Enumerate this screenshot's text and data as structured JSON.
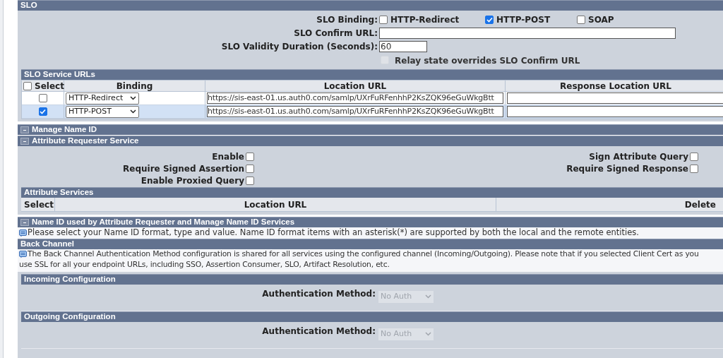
{
  "slo": {
    "title": "SLO",
    "binding_label": "SLO Binding:",
    "bindings": [
      {
        "label": "HTTP-Redirect",
        "checked": false
      },
      {
        "label": "HTTP-POST",
        "checked": true
      },
      {
        "label": "SOAP",
        "checked": false
      }
    ],
    "confirm_url_label": "SLO Confirm URL:",
    "validity_label": "SLO Validity Duration (Seconds):",
    "validity_value": "60",
    "relay": {
      "label": "Relay state overrides SLO Confirm URL",
      "checked": false,
      "disabled": true
    },
    "service_urls": {
      "title": "SLO Service URLs",
      "select_all": {
        "label": "Select",
        "checked": false
      },
      "columns": [
        "Binding",
        "Location URL",
        "Response Location URL"
      ],
      "rows": [
        {
          "selected": false,
          "binding": "HTTP-Redirect",
          "location": "https://sis-east-01.us.auth0.com/samlp/UXrFuRFenhhP2KsZQK96eGuWkgBtt"
        },
        {
          "selected": true,
          "binding": "HTTP-POST",
          "location": "https://sis-east-01.us.auth0.com/samlp/UXrFuRFenhhP2KsZQK96eGuWkgBtt"
        }
      ]
    }
  },
  "manage_name_id": {
    "title": "Manage Name ID"
  },
  "attribute_requester": {
    "title": "Attribute Requester Service",
    "left_options": [
      {
        "label": "Enable",
        "checked": false
      },
      {
        "label": "Require Signed Assertion",
        "checked": false
      },
      {
        "label": "Enable Proxied Query",
        "checked": false
      }
    ],
    "right_options": [
      {
        "label": "Sign Attribute Query",
        "checked": false
      },
      {
        "label": "Require Signed Response",
        "checked": false
      }
    ],
    "services": {
      "title": "Attribute Services",
      "columns": [
        "Select",
        "Location URL",
        "Delete"
      ]
    }
  },
  "name_id": {
    "title": "Name ID used by Attribute Requester and Manage Name ID Services",
    "note": "Please select your Name ID format, type and value. Name ID format items with an asterisk(*) are supported by both the local and the remote entities."
  },
  "back_channel": {
    "title": "Back Channel",
    "note_lines": [
      "The Back Channel Authentication Method configuration is shared for all services using the configured channel (Incoming/Outgoing). Please note that if you selected Client Cert as you",
      "use SSL for all your endpoint URLs, including SSO, Assertion Consumer, SLO, Artifact Resolution, etc."
    ],
    "configs": [
      {
        "title": "Incoming Configuration",
        "label": "Authentication Method:",
        "value": "No Auth",
        "disabled": true
      },
      {
        "title": "Outgoing Configuration",
        "label": "Authentication Method:",
        "value": "No Auth",
        "disabled": true
      }
    ]
  }
}
